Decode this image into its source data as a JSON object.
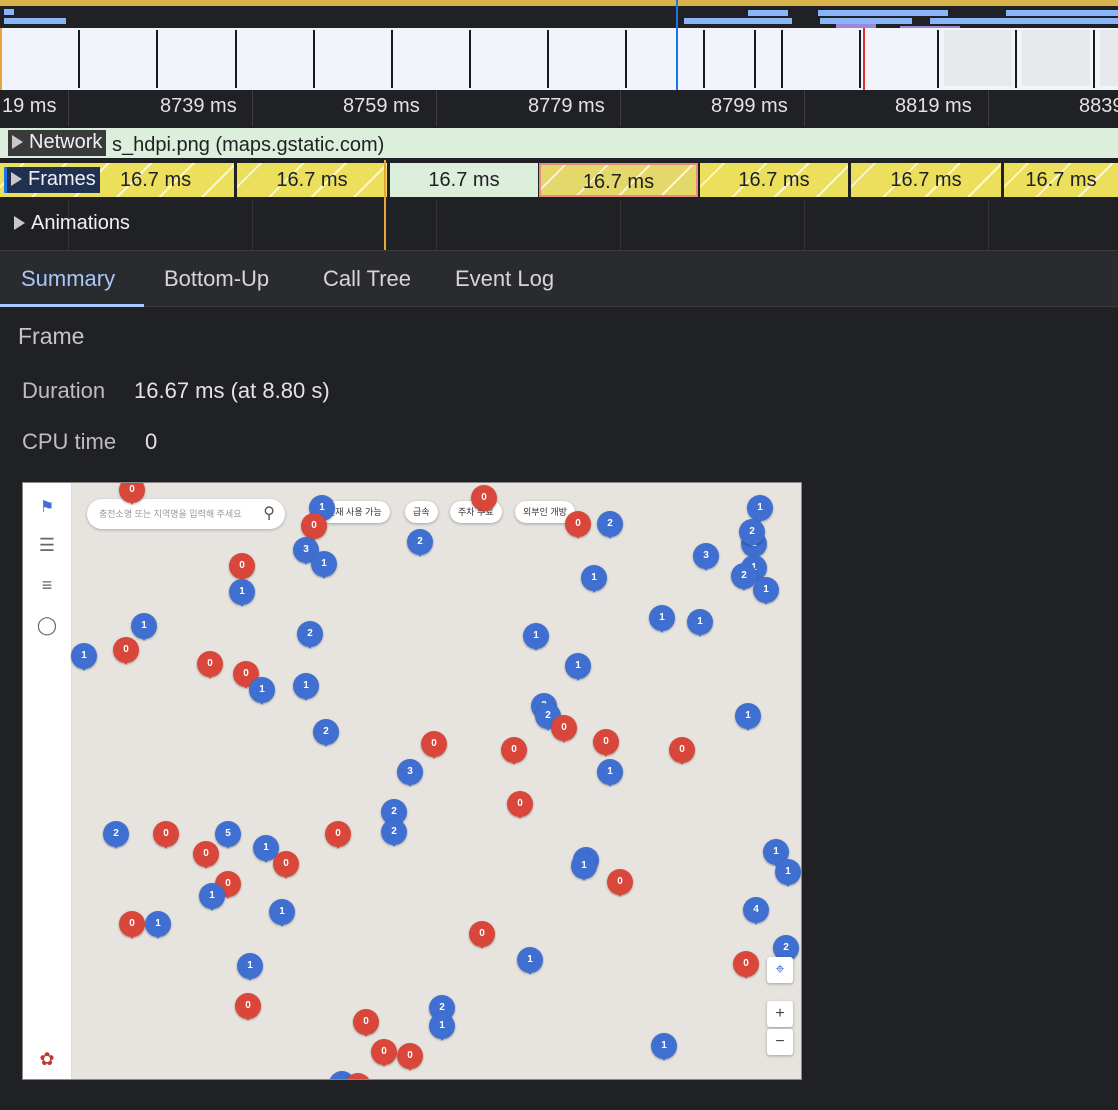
{
  "ruler": {
    "labels": [
      "19 ms",
      "8739 ms",
      "8759 ms",
      "8779 ms",
      "8799 ms",
      "8819 ms",
      "8839"
    ]
  },
  "tracks": {
    "network": {
      "label": "Network",
      "request_text": "s_hdpi.png (maps.gstatic.com)"
    },
    "frames": {
      "label": "Frames",
      "items": [
        "16.7 ms",
        "16.7 ms",
        "16.7 ms",
        "16.7 ms",
        "16.7 ms",
        "16.7 ms",
        "16.7 ms"
      ]
    },
    "animations": {
      "label": "Animations"
    }
  },
  "tabs": [
    "Summary",
    "Bottom-Up",
    "Call Tree",
    "Event Log"
  ],
  "active_tab": "Summary",
  "summary": {
    "title": "Frame",
    "duration_label": "Duration",
    "duration_value": "16.67 ms (at 8.80 s)",
    "cpu_label": "CPU time",
    "cpu_value": "0"
  },
  "screenshot": {
    "search_placeholder": "충전소명 또는 지역명을 입력해 주세요",
    "chips": [
      "현재 사용 가능",
      "급속",
      "주차 무료",
      "외부인 개방"
    ],
    "zoom_in": "+",
    "zoom_out": "−",
    "pins": [
      {
        "c": "red",
        "t": "0"
      },
      {
        "c": "blue",
        "t": "1"
      },
      {
        "c": "red",
        "t": "0"
      },
      {
        "c": "red",
        "t": "0"
      },
      {
        "c": "blue",
        "t": "1"
      },
      {
        "c": "blue",
        "t": "3"
      },
      {
        "c": "blue",
        "t": "1"
      },
      {
        "c": "blue",
        "t": "2"
      },
      {
        "c": "red",
        "t": "0"
      },
      {
        "c": "red",
        "t": "0"
      },
      {
        "c": "blue",
        "t": "2"
      },
      {
        "c": "blue",
        "t": "1"
      },
      {
        "c": "blue",
        "t": "2"
      },
      {
        "c": "blue",
        "t": "3"
      },
      {
        "c": "blue",
        "t": "2"
      },
      {
        "c": "blue",
        "t": "1"
      },
      {
        "c": "blue",
        "t": "2"
      },
      {
        "c": "blue",
        "t": "1"
      },
      {
        "c": "blue",
        "t": "1"
      },
      {
        "c": "blue",
        "t": "1"
      },
      {
        "c": "blue",
        "t": "1"
      },
      {
        "c": "red",
        "t": "0"
      },
      {
        "c": "red",
        "t": "0"
      },
      {
        "c": "red",
        "t": "0"
      },
      {
        "c": "blue",
        "t": "2"
      },
      {
        "c": "blue",
        "t": "1"
      },
      {
        "c": "blue",
        "t": "1"
      },
      {
        "c": "blue",
        "t": "1"
      },
      {
        "c": "blue",
        "t": "2"
      },
      {
        "c": "blue",
        "t": "1"
      },
      {
        "c": "blue",
        "t": "1"
      },
      {
        "c": "blue",
        "t": "1"
      },
      {
        "c": "blue",
        "t": "2"
      },
      {
        "c": "blue",
        "t": "1"
      },
      {
        "c": "red",
        "t": "0"
      },
      {
        "c": "blue",
        "t": "3"
      },
      {
        "c": "red",
        "t": "0"
      },
      {
        "c": "red",
        "t": "0"
      },
      {
        "c": "red",
        "t": "0"
      },
      {
        "c": "red",
        "t": "0"
      },
      {
        "c": "blue",
        "t": "1"
      },
      {
        "c": "blue",
        "t": "2"
      },
      {
        "c": "red",
        "t": "0"
      },
      {
        "c": "blue",
        "t": "2"
      },
      {
        "c": "blue",
        "t": "2"
      },
      {
        "c": "blue",
        "t": "2"
      },
      {
        "c": "red",
        "t": "0"
      },
      {
        "c": "red",
        "t": "0"
      },
      {
        "c": "blue",
        "t": "5"
      },
      {
        "c": "blue",
        "t": "1"
      },
      {
        "c": "red",
        "t": "0"
      },
      {
        "c": "red",
        "t": "0"
      },
      {
        "c": "blue",
        "t": "1"
      },
      {
        "c": "red",
        "t": "0"
      },
      {
        "c": "blue",
        "t": "1"
      },
      {
        "c": "blue",
        "t": "1"
      },
      {
        "c": "red",
        "t": "0"
      },
      {
        "c": "blue",
        "t": "1"
      },
      {
        "c": "blue",
        "t": "1"
      },
      {
        "c": "red",
        "t": "0"
      },
      {
        "c": "blue",
        "t": "1"
      },
      {
        "c": "blue",
        "t": "4"
      },
      {
        "c": "blue",
        "t": "1"
      },
      {
        "c": "red",
        "t": "0"
      },
      {
        "c": "blue",
        "t": "2"
      },
      {
        "c": "blue",
        "t": "1"
      },
      {
        "c": "red",
        "t": "0"
      },
      {
        "c": "red",
        "t": "0"
      },
      {
        "c": "red",
        "t": "0"
      },
      {
        "c": "red",
        "t": "0"
      },
      {
        "c": "blue",
        "t": "2"
      },
      {
        "c": "blue",
        "t": "1"
      },
      {
        "c": "blue",
        "t": "1"
      },
      {
        "c": "red",
        "t": "0"
      },
      {
        "c": "blue",
        "t": "1"
      },
      {
        "c": "blue",
        "t": "1"
      },
      {
        "c": "red",
        "t": "0"
      }
    ]
  },
  "colors": {
    "panel_bg": "#202124",
    "accent_tab": "#a8c7fa",
    "frame_partial": "#ecdf5b",
    "frame_idle": "#dcefdc",
    "frame_selected_border": "#e88b80",
    "pin_blue": "#3f6fd1",
    "pin_red": "#d9473b"
  },
  "icons": [
    "expand-triangle-icon",
    "search-icon",
    "menu-icon",
    "sliders-icon",
    "profile-icon",
    "locate-icon",
    "logo-icon"
  ]
}
